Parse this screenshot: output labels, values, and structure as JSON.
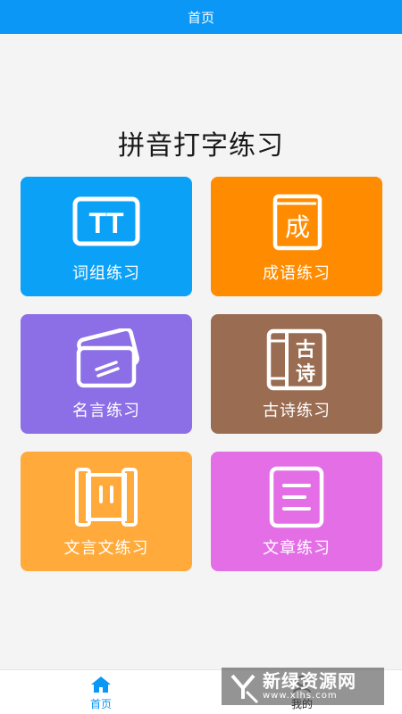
{
  "header": {
    "title": "首页"
  },
  "page_title": "拼音打字练习",
  "cards": [
    {
      "label": "词组练习",
      "icon": "text-tt-icon",
      "color": "#0aa1f7"
    },
    {
      "label": "成语练习",
      "icon": "idiom-book-icon",
      "color": "#ff8c00"
    },
    {
      "label": "名言练习",
      "icon": "quote-cards-icon",
      "color": "#8c6fe6"
    },
    {
      "label": "古诗练习",
      "icon": "poem-book-icon",
      "color": "#9a6d53"
    },
    {
      "label": "文言文练习",
      "icon": "scroll-icon",
      "color": "#ffaa3a"
    },
    {
      "label": "文章练习",
      "icon": "article-icon",
      "color": "#e46ee6"
    }
  ],
  "icon_text": {
    "tt": "TT",
    "idiom": "成",
    "poem_line1": "古",
    "poem_line2": "诗"
  },
  "tabbar": {
    "items": [
      {
        "label": "首页",
        "icon": "home-icon",
        "active": true
      },
      {
        "label": "我的",
        "icon": "user-icon",
        "active": false
      }
    ],
    "active_color": "#0a97f5"
  },
  "watermark": {
    "text": "新绿资源网",
    "url": "www.xlhs.com"
  }
}
